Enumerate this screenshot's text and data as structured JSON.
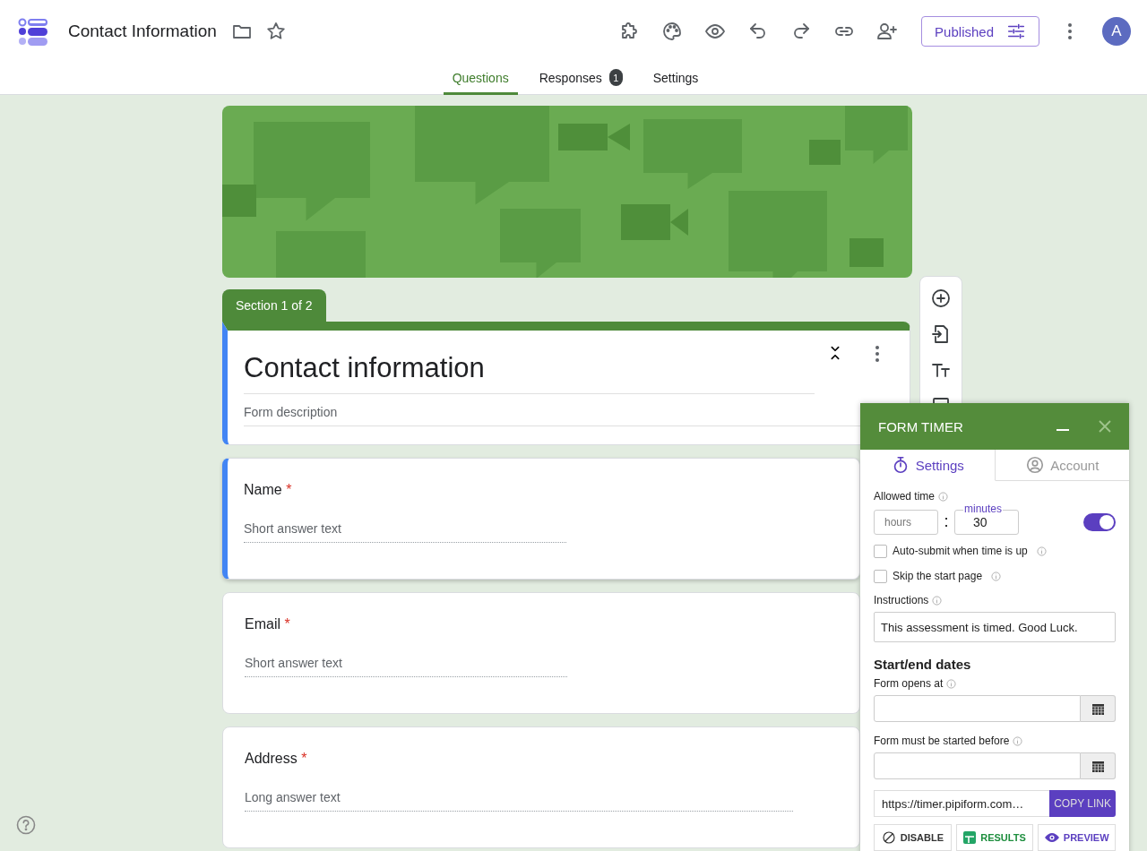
{
  "header": {
    "title": "Contact Information",
    "publish_button": "Published",
    "avatar": "A"
  },
  "tabs": [
    {
      "label": "Questions",
      "selected": true
    },
    {
      "label": "Responses",
      "selected": false,
      "badge": "1"
    },
    {
      "label": "Settings",
      "selected": false
    }
  ],
  "section": {
    "label": "Section 1 of 2",
    "title": "Contact information",
    "description_placeholder": "Form description"
  },
  "questions": [
    {
      "title": "Name",
      "required_mark": "*",
      "placeholder": "Short answer text",
      "kind": "short",
      "selected": true
    },
    {
      "title": "Email",
      "required_mark": "*",
      "placeholder": "Short answer text",
      "kind": "short",
      "selected": false
    },
    {
      "title": "Address",
      "required_mark": "*",
      "placeholder": "Long answer text",
      "kind": "long",
      "selected": false
    }
  ],
  "timer": {
    "title": "FORM TIMER",
    "tabs": [
      {
        "label": "Settings",
        "selected": true,
        "kind": "timer"
      },
      {
        "label": "Account",
        "selected": false,
        "kind": "account"
      }
    ],
    "allowed_time_label": "Allowed time",
    "hours_placeholder": "hours",
    "minutes_label": "minutes",
    "minutes_value": "30",
    "enabled": true,
    "options": [
      {
        "label": "Auto-submit when time is up",
        "checked": false
      },
      {
        "label": "Skip the start page",
        "checked": false
      }
    ],
    "instructions_label": "Instructions",
    "instructions": "This assessment is timed. Good Luck.",
    "dates_heading": "Start/end dates",
    "dates": [
      {
        "label": "Form opens at"
      },
      {
        "label": "Form must be started before"
      }
    ],
    "link": "https://timer.pipiform.com…",
    "copy_button": "COPY LINK",
    "actions": [
      {
        "label": "DISABLE",
        "kind": "disable"
      },
      {
        "label": "RESULTS",
        "kind": "results"
      },
      {
        "label": "PREVIEW",
        "kind": "preview"
      }
    ]
  }
}
